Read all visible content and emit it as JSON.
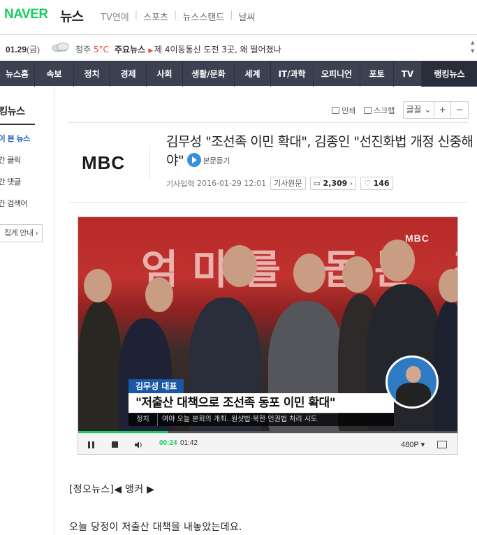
{
  "header": {
    "logo": "NAVER",
    "section": "뉴스",
    "top_nav": [
      "TV연예",
      "스포츠",
      "뉴스스탠드",
      "날씨"
    ]
  },
  "infobar": {
    "date": "01.29",
    "weekday": "(금)",
    "city": "청주",
    "temperature": "5°C",
    "key_news_label": "주요뉴스",
    "headline": "제 4이동통신 도전 3곳, 왜 떨어졌나"
  },
  "main_nav": [
    "뉴스홈",
    "속보",
    "정치",
    "경제",
    "사회",
    "생활/문화",
    "세계",
    "IT/과학",
    "오피니언",
    "포토",
    "TV",
    "랭킹뉴스"
  ],
  "sidebar": {
    "title": "랭킹뉴스",
    "items": [
      "많이 본 뉴스",
      "주간 클릭",
      "주간 댓글",
      "주간 검색어"
    ],
    "button": "집계 안내"
  },
  "tools": {
    "print": "인쇄",
    "scrap": "스크랩",
    "font_label": "글꼴",
    "font_plus": "+",
    "font_minus": "−"
  },
  "article": {
    "press": "MBC",
    "title": "김무성 \"조선족 이민 확대\", 김종인 \"선진화법 개정 신중해야\"",
    "listen": "본문듣기",
    "input_label": "기사입력",
    "timestamp": "2016-01-29 12:01",
    "original_label": "기사원문",
    "comments": "2,309",
    "likes": "146",
    "body_line1": "[정오뉴스]◀ 앵커 ▶",
    "body_line2": "오늘 당정이 저출산 대책을 내놓았는데요."
  },
  "video": {
    "watermark": "MBC",
    "caption_name": "김무성 대표",
    "caption_main": "\"저출산 대책으로 조선족 동포 이민 확대\"",
    "caption_tag": "정치",
    "caption_sub": "여야 오늘 본회의 개최‥원샷법·북한 인권법 처리 시도",
    "current_time": "00:24",
    "total_time": "01:42",
    "quality": "480P",
    "progress": 0.235,
    "colors": {
      "accent": "#19ce60",
      "caption_blue": "#1b57a8"
    }
  }
}
